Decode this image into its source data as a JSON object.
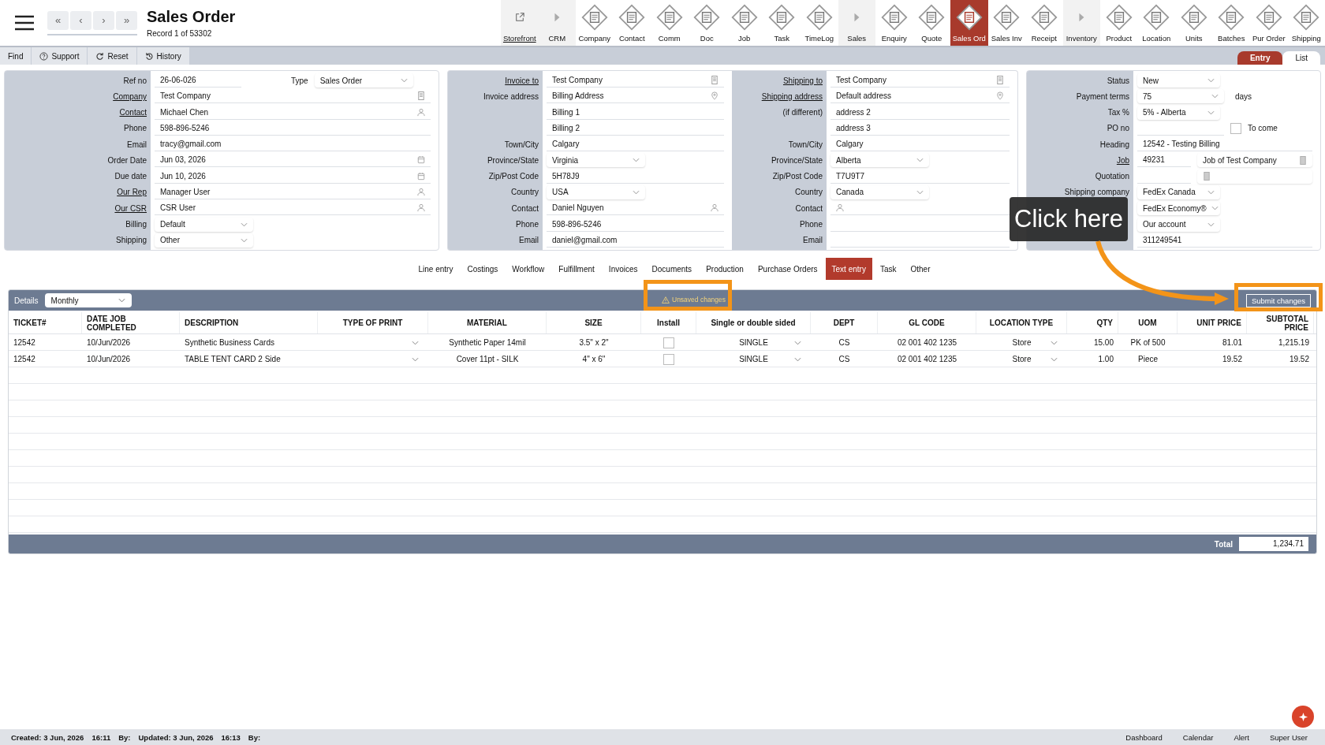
{
  "header": {
    "title": "Sales Order",
    "record": "Record 1 of 53302",
    "nav": [
      "«",
      "‹",
      "›",
      "»"
    ]
  },
  "modules": [
    {
      "label": "Storefront",
      "kind": "link",
      "selected": false
    },
    {
      "label": "CRM",
      "kind": "section",
      "selected": false
    },
    {
      "label": "Company",
      "kind": "module",
      "selected": false
    },
    {
      "label": "Contact",
      "kind": "module",
      "selected": false
    },
    {
      "label": "Comm",
      "kind": "module",
      "selected": false
    },
    {
      "label": "Doc",
      "kind": "module",
      "selected": false
    },
    {
      "label": "Job",
      "kind": "module",
      "selected": false
    },
    {
      "label": "Task",
      "kind": "module",
      "selected": false
    },
    {
      "label": "TimeLog",
      "kind": "module",
      "selected": false
    },
    {
      "label": "Sales",
      "kind": "section",
      "selected": false
    },
    {
      "label": "Enquiry",
      "kind": "module",
      "selected": false
    },
    {
      "label": "Quote",
      "kind": "module",
      "selected": false
    },
    {
      "label": "Sales Ord",
      "kind": "module",
      "selected": true
    },
    {
      "label": "Sales Inv",
      "kind": "module",
      "selected": false
    },
    {
      "label": "Receipt",
      "kind": "module",
      "selected": false
    },
    {
      "label": "Inventory",
      "kind": "section",
      "selected": false
    },
    {
      "label": "Product",
      "kind": "module",
      "selected": false
    },
    {
      "label": "Location",
      "kind": "module",
      "selected": false
    },
    {
      "label": "Units",
      "kind": "module",
      "selected": false
    },
    {
      "label": "Batches",
      "kind": "module",
      "selected": false
    },
    {
      "label": "Pur Order",
      "kind": "module",
      "selected": false
    },
    {
      "label": "Shipping",
      "kind": "module",
      "selected": false
    }
  ],
  "toolbar": [
    {
      "label": "Find"
    },
    {
      "label": "Support"
    },
    {
      "label": "Reset"
    },
    {
      "label": "History"
    }
  ],
  "view_tabs": [
    {
      "label": "Entry",
      "selected": true
    },
    {
      "label": "List",
      "selected": false
    }
  ],
  "panels": [
    {
      "rows": [
        {
          "label": "Ref no",
          "kind": "pair",
          "value": "26-06-026",
          "label2": "Type",
          "value2": "Sales Order"
        },
        {
          "label": "Company",
          "link": true,
          "kind": "text",
          "value": "Test Company"
        },
        {
          "label": "Contact",
          "link": true,
          "kind": "text",
          "value": "Michael Chen"
        },
        {
          "label": "Phone",
          "kind": "text",
          "value": "598-896-5246"
        },
        {
          "label": "Email",
          "kind": "text",
          "value": "tracy@gmail.com"
        },
        {
          "label": "Order Date",
          "kind": "text",
          "value": "Jun 03, 2026"
        },
        {
          "label": "Due date",
          "kind": "text",
          "value": "Jun 10, 2026"
        },
        {
          "label": "Our Rep",
          "link": true,
          "kind": "text",
          "value": "Manager User"
        },
        {
          "label": "Our CSR",
          "link": true,
          "kind": "text",
          "value": "CSR User"
        },
        {
          "label": "Billing",
          "kind": "select",
          "value": "Default"
        },
        {
          "label": "Shipping",
          "kind": "select",
          "value": "Other"
        }
      ]
    },
    {
      "rows": [
        {
          "label": "Invoice to",
          "link": true,
          "kind": "text",
          "value": "Test Company"
        },
        {
          "label": "Invoice address",
          "kind": "text",
          "value": "Billing Address"
        },
        {
          "kind": "text",
          "value": "Billing 1"
        },
        {
          "kind": "text",
          "value": "Billing 2"
        },
        {
          "label": "Town/City",
          "kind": "text",
          "value": "Calgary"
        },
        {
          "label": "Province/State",
          "kind": "select",
          "value": "Virginia"
        },
        {
          "label": "Zip/Post Code",
          "kind": "text",
          "value": "5H78J9"
        },
        {
          "label": "Country",
          "kind": "select",
          "value": "USA"
        },
        {
          "label": "Contact",
          "kind": "text",
          "value": "Daniel Nguyen"
        },
        {
          "label": "Phone",
          "kind": "text",
          "value": "598-896-5246"
        },
        {
          "label": "Email",
          "kind": "text",
          "value": "daniel@gmail.com"
        }
      ]
    },
    {
      "rows": [
        {
          "label": "Shipping to",
          "link": true,
          "kind": "text",
          "value": "Test Company"
        },
        {
          "label": "Shipping address",
          "link": true,
          "kind": "text",
          "value": "Default address"
        },
        {
          "label": "(if different)",
          "kind": "text",
          "value": "address 2"
        },
        {
          "kind": "text",
          "value": "address 3"
        },
        {
          "label": "Town/City",
          "kind": "text",
          "value": "Calgary"
        },
        {
          "label": "Province/State",
          "kind": "select",
          "value": "Alberta"
        },
        {
          "label": "Zip/Post Code",
          "kind": "text",
          "value": "T7U9T7"
        },
        {
          "label": "Country",
          "kind": "select",
          "value": "Canada"
        },
        {
          "label": "Contact",
          "kind": "text"
        },
        {
          "label": "Phone",
          "kind": "text"
        },
        {
          "label": "Email",
          "kind": "text"
        }
      ]
    },
    {
      "rows": [
        {
          "label": "Status",
          "kind": "select",
          "value": "New"
        },
        {
          "label": "Payment terms",
          "kind": "select",
          "value": "75",
          "suffix": "days"
        },
        {
          "label": "Tax %",
          "kind": "select",
          "value": "5% - Alberta"
        },
        {
          "label": "PO no",
          "kind": "check",
          "check_label": "To come",
          "checked": false
        },
        {
          "label": "Heading",
          "kind": "text",
          "value": "12542 - Testing Billing"
        },
        {
          "label": "Job",
          "link": true,
          "kind": "double",
          "value": "49231",
          "value2": "Job of Test Company"
        },
        {
          "label": "Quotation",
          "kind": "double"
        },
        {
          "label": "Shipping company",
          "kind": "select",
          "value": "FedEx Canada"
        },
        {
          "kind": "select",
          "value": "FedEx Economy®"
        },
        {
          "kind": "select",
          "value": "Our account"
        },
        {
          "kind": "text",
          "value": "311249541"
        }
      ]
    }
  ],
  "section_tabs": [
    {
      "label": "Line entry",
      "selected": false
    },
    {
      "label": "Costings",
      "selected": false
    },
    {
      "label": "Workflow",
      "selected": false
    },
    {
      "label": "Fulfillment",
      "selected": false
    },
    {
      "label": "Invoices",
      "selected": false
    },
    {
      "label": "Documents",
      "selected": false
    },
    {
      "label": "Production",
      "selected": false
    },
    {
      "label": "Purchase Orders",
      "selected": false
    },
    {
      "label": "Text entry",
      "selected": true
    },
    {
      "label": "Task",
      "selected": false
    },
    {
      "label": "Other",
      "selected": false
    }
  ],
  "grid": {
    "details_label": "Details",
    "period": "Monthly",
    "notice": "Unsaved changes",
    "submit": "Submit changes",
    "columns": [
      {
        "label": "TICKET#",
        "kind": "text"
      },
      {
        "label": "DATE JOB COMPLETED",
        "kind": "text"
      },
      {
        "label": "DESCRIPTION",
        "kind": "text"
      },
      {
        "label": "TYPE OF PRINT",
        "kind": "select"
      },
      {
        "label": "MATERIAL",
        "kind": "text"
      },
      {
        "label": "SIZE",
        "kind": "text"
      },
      {
        "label": "Install",
        "kind": "check"
      },
      {
        "label": "Single or double sided",
        "kind": "select"
      },
      {
        "label": "DEPT",
        "kind": "text"
      },
      {
        "label": "GL CODE",
        "kind": "text"
      },
      {
        "label": "LOCATION TYPE",
        "kind": "select"
      },
      {
        "label": "QTY",
        "kind": "text"
      },
      {
        "label": "UOM",
        "kind": "text"
      },
      {
        "label": "UNIT PRICE",
        "kind": "text"
      },
      {
        "label": "SUBTOTAL PRICE",
        "kind": "text"
      }
    ],
    "rows": [
      {
        "ticket": "12542",
        "date": "10/Jun/2026",
        "description": "Synthetic Business Cards",
        "material": "Synthetic Paper 14mil",
        "size": "3.5\" x 2\"",
        "install": false,
        "sides": "SINGLE",
        "dept": "CS",
        "gl_code": "02 001 402 1235",
        "location": "Store",
        "qty": "15.00",
        "uom": "PK of 500",
        "unit_price": "81.01",
        "subtotal": "1,215.19"
      },
      {
        "ticket": "12542",
        "date": "10/Jun/2026",
        "description": "TABLE TENT CARD 2 Side",
        "material": "Cover 11pt - SILK",
        "size": "4\" x 6\"",
        "install": false,
        "sides": "SINGLE",
        "dept": "CS",
        "gl_code": "02 001 402 1235",
        "location": "Store",
        "qty": "1.00",
        "uom": "Piece",
        "unit_price": "19.52",
        "subtotal": "19.52"
      }
    ],
    "total_label": "Total",
    "total": "1,234.71"
  },
  "status_bar": {
    "left": [
      "Created: 3 Jun, 2026",
      "16:11",
      "By:",
      "Updated: 3 Jun, 2026",
      "16:13",
      "By:"
    ],
    "right": [
      "Dashboard",
      "Calendar",
      "Alert",
      "Super User"
    ]
  },
  "callout": {
    "text": "Click here"
  }
}
